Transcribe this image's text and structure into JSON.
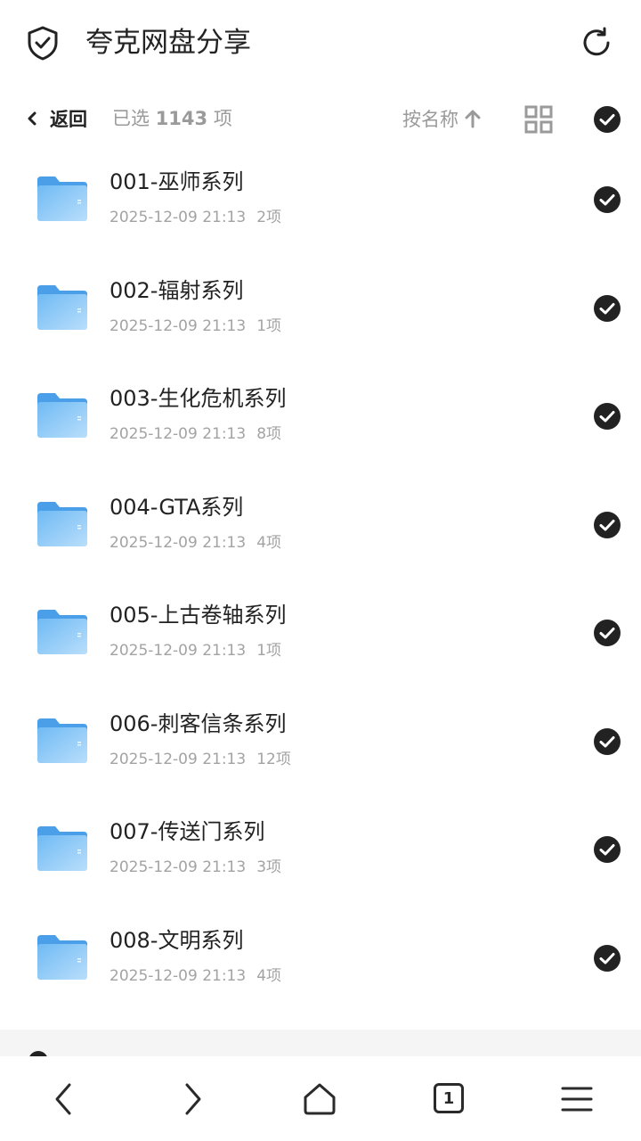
{
  "header": {
    "title": "夸克网盘分享",
    "shield_icon": "shield-check-icon",
    "refresh_icon": "refresh-icon"
  },
  "selection_bar": {
    "back_label": "返回",
    "selected_prefix": "已选",
    "selected_count": "1143",
    "selected_suffix": "项",
    "sort_label": "按名称",
    "sort_icon": "arrow-up-icon",
    "view_icon": "grid-view-icon",
    "select_all_checked": true
  },
  "files": [
    {
      "name": "001-巫师系列",
      "date": "2025-12-09 21:13",
      "count": "2项",
      "checked": true
    },
    {
      "name": "002-辐射系列",
      "date": "2025-12-09 21:13",
      "count": "1项",
      "checked": true
    },
    {
      "name": "003-生化危机系列",
      "date": "2025-12-09 21:13",
      "count": "8项",
      "checked": true
    },
    {
      "name": "004-GTA系列",
      "date": "2025-12-09 21:13",
      "count": "4项",
      "checked": true
    },
    {
      "name": "005-上古卷轴系列",
      "date": "2025-12-09 21:13",
      "count": "1项",
      "checked": true
    },
    {
      "name": "006-刺客信条系列",
      "date": "2025-12-09 21:13",
      "count": "12项",
      "checked": true
    },
    {
      "name": "007-传送门系列",
      "date": "2025-12-09 21:13",
      "count": "3项",
      "checked": true
    },
    {
      "name": "008-文明系列",
      "date": "2025-12-09 21:13",
      "count": "4项",
      "checked": true
    }
  ],
  "bottom_nav": {
    "tab_count": "1"
  },
  "colors": {
    "folder_blue": "#5aaef0",
    "check_dark": "#222222",
    "meta_gray": "#a3a3a3"
  }
}
